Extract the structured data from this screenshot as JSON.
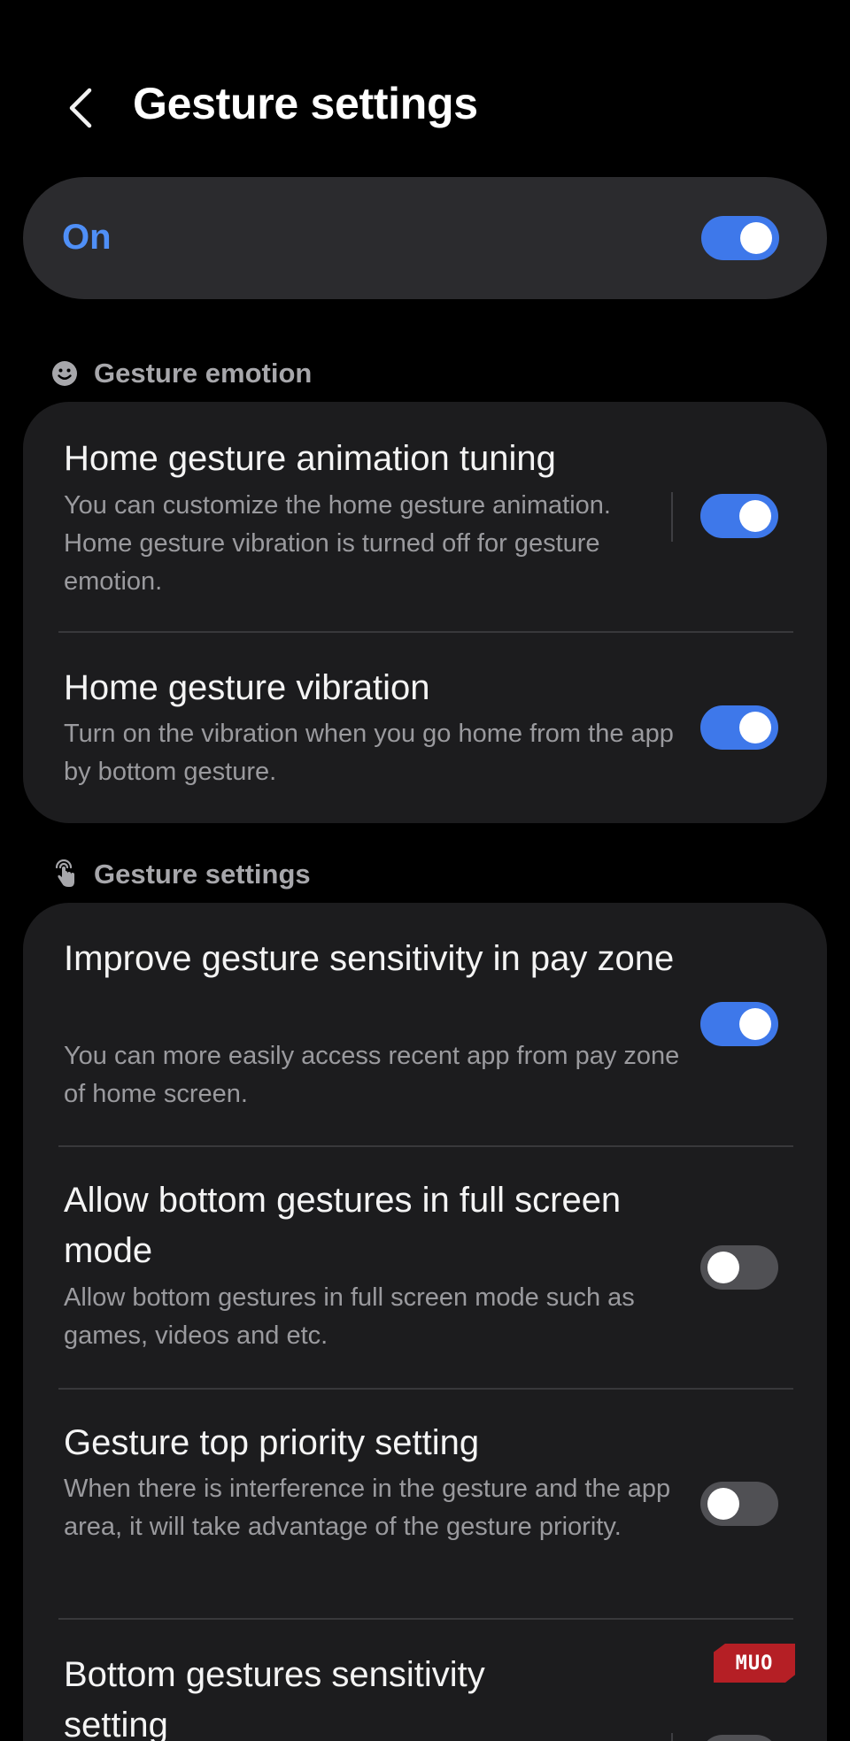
{
  "header": {
    "title": "Gesture settings"
  },
  "master_switch": {
    "label": "On",
    "state": "on"
  },
  "sections": [
    {
      "header": "Gesture emotion",
      "icon": "smiley-icon",
      "items": [
        {
          "title": "Home gesture animation tuning",
          "description": "You can customize the home gesture animation. Home gesture vibration is turned off for gesture emotion.",
          "switch": "on"
        },
        {
          "title": "Home gesture vibration",
          "description": "Turn on the vibration when you go home from the app by bottom gesture.",
          "switch": "on"
        }
      ]
    },
    {
      "header": "Gesture settings",
      "icon": "touch-hand-icon",
      "items": [
        {
          "title": "Improve gesture sensitivity in pay zone",
          "description": "You can more easily access recent app from pay zone of home screen.",
          "switch": "on"
        },
        {
          "title": "Allow bottom gestures in full screen mode",
          "description": "Allow bottom gestures in full screen mode such as games, videos and etc.",
          "switch": "off"
        },
        {
          "title": "Gesture top priority setting",
          "description": "When there is interference in the gesture and the app area, it will take advantage of the gesture priority.",
          "switch": "off"
        },
        {
          "title": "Bottom gestures sensitivity setting",
          "switch": "off"
        }
      ]
    }
  ],
  "watermark": {
    "text": "MUO"
  },
  "colors": {
    "accent": "#3e78ea",
    "accent_text": "#4f8ff7",
    "switch_off": "#505054",
    "card": "#1c1c1e",
    "background": "#000000",
    "logo": "#b51f25"
  }
}
